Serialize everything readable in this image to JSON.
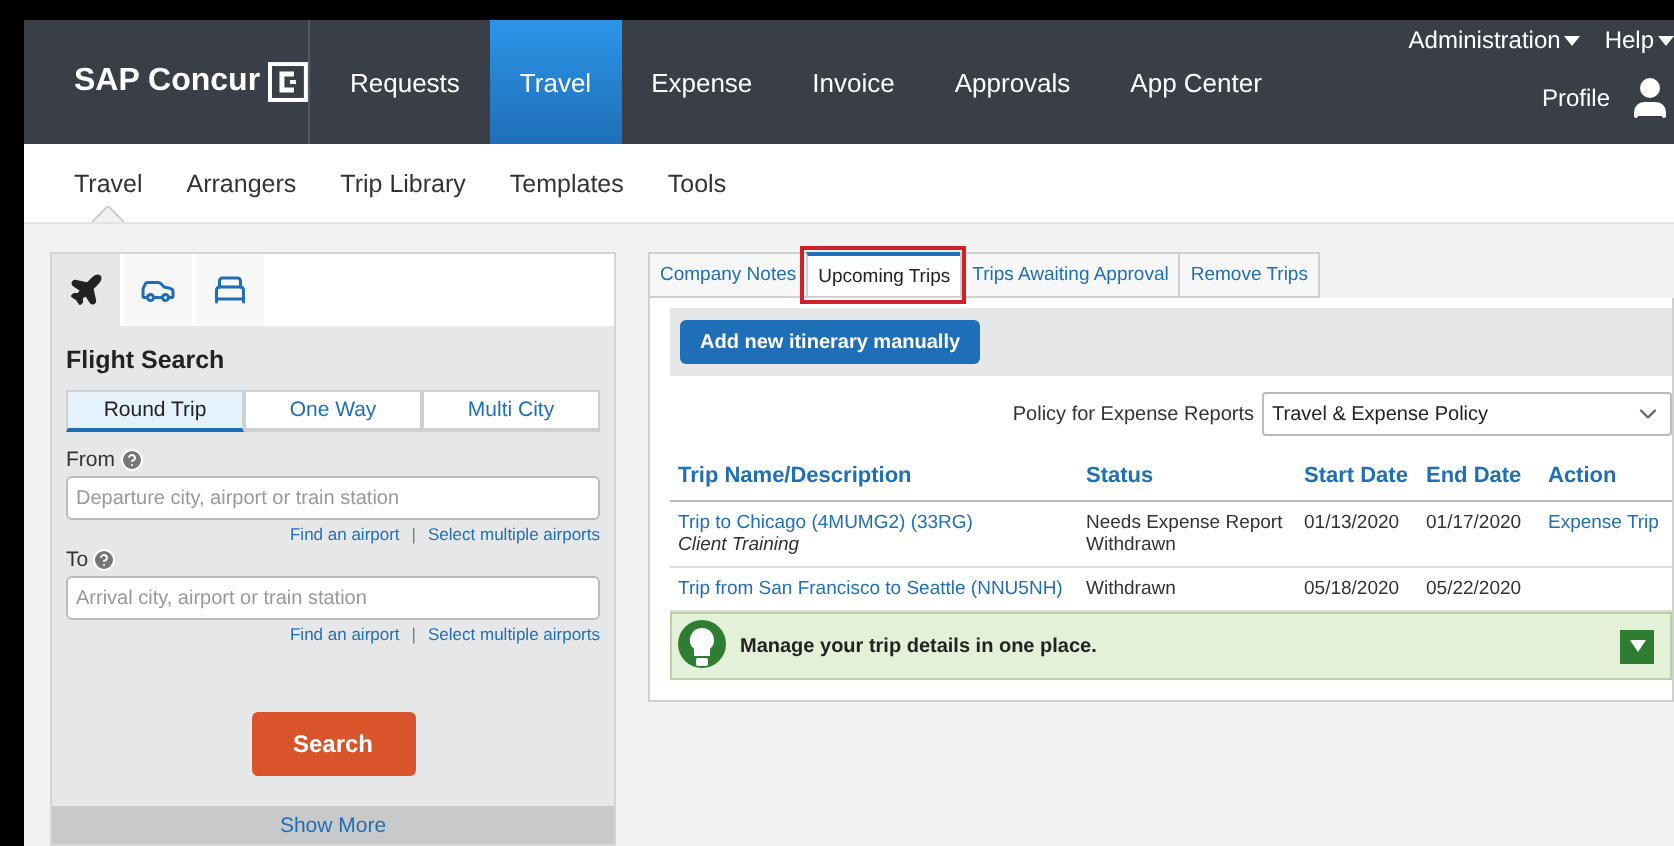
{
  "brand": {
    "name": "SAP Concur"
  },
  "nav": [
    {
      "label": "Requests",
      "selected": false
    },
    {
      "label": "Travel",
      "selected": true
    },
    {
      "label": "Expense",
      "selected": false
    },
    {
      "label": "Invoice",
      "selected": false
    },
    {
      "label": "Approvals",
      "selected": false
    },
    {
      "label": "App Center",
      "selected": false
    }
  ],
  "top_links": [
    {
      "label": "Administration"
    },
    {
      "label": "Help"
    }
  ],
  "profile": {
    "label": "Profile"
  },
  "subnav": [
    {
      "label": "Travel",
      "selected": true
    },
    {
      "label": "Arrangers",
      "selected": false
    },
    {
      "label": "Trip Library",
      "selected": false
    },
    {
      "label": "Templates",
      "selected": false
    },
    {
      "label": "Tools",
      "selected": false
    }
  ],
  "search_panel": {
    "modes": [
      {
        "kind": "flight",
        "selected": true
      },
      {
        "kind": "car",
        "selected": false
      },
      {
        "kind": "hotel",
        "selected": false
      }
    ],
    "title": "Flight Search",
    "trip_types": [
      {
        "label": "Round Trip",
        "selected": true
      },
      {
        "label": "One Way",
        "selected": false
      },
      {
        "label": "Multi City",
        "selected": false
      }
    ],
    "fields": [
      {
        "label": "From",
        "placeholder": "Departure city, airport or train station",
        "links": [
          "Find an airport",
          "Select multiple airports"
        ]
      },
      {
        "label": "To",
        "placeholder": "Arrival city, airport or train station",
        "links": [
          "Find an airport",
          "Select multiple airports"
        ]
      }
    ],
    "link_separator": "|",
    "search_button": "Search",
    "show_more": "Show More"
  },
  "trips_panel": {
    "tabs": [
      {
        "label": "Company Notes",
        "selected": false,
        "highlighted": false
      },
      {
        "label": "Upcoming Trips",
        "selected": true,
        "highlighted": true
      },
      {
        "label": "Trips Awaiting Approval",
        "selected": false,
        "highlighted": false
      },
      {
        "label": "Remove Trips",
        "selected": false,
        "highlighted": false
      }
    ],
    "add_button": "Add new itinerary manually",
    "policy": {
      "label": "Policy for Expense Reports",
      "value": "Travel & Expense Policy"
    },
    "columns": [
      "Trip Name/Description",
      "Status",
      "Start Date",
      "End Date",
      "Action"
    ],
    "rows": [
      {
        "name": "Trip to Chicago (4MUMG2) (33RG)",
        "description": "Client Training",
        "status": [
          "Needs Expense Report",
          "Withdrawn"
        ],
        "start": "01/13/2020",
        "end": "01/17/2020",
        "action": "Expense Trip"
      },
      {
        "name": "Trip from San Francisco to Seattle (NNU5NH)",
        "status": [
          "Withdrawn"
        ],
        "start": "05/18/2020",
        "end": "05/22/2020"
      }
    ],
    "tip": {
      "text": "Manage your trip details in one place.",
      "expanded": false
    }
  }
}
